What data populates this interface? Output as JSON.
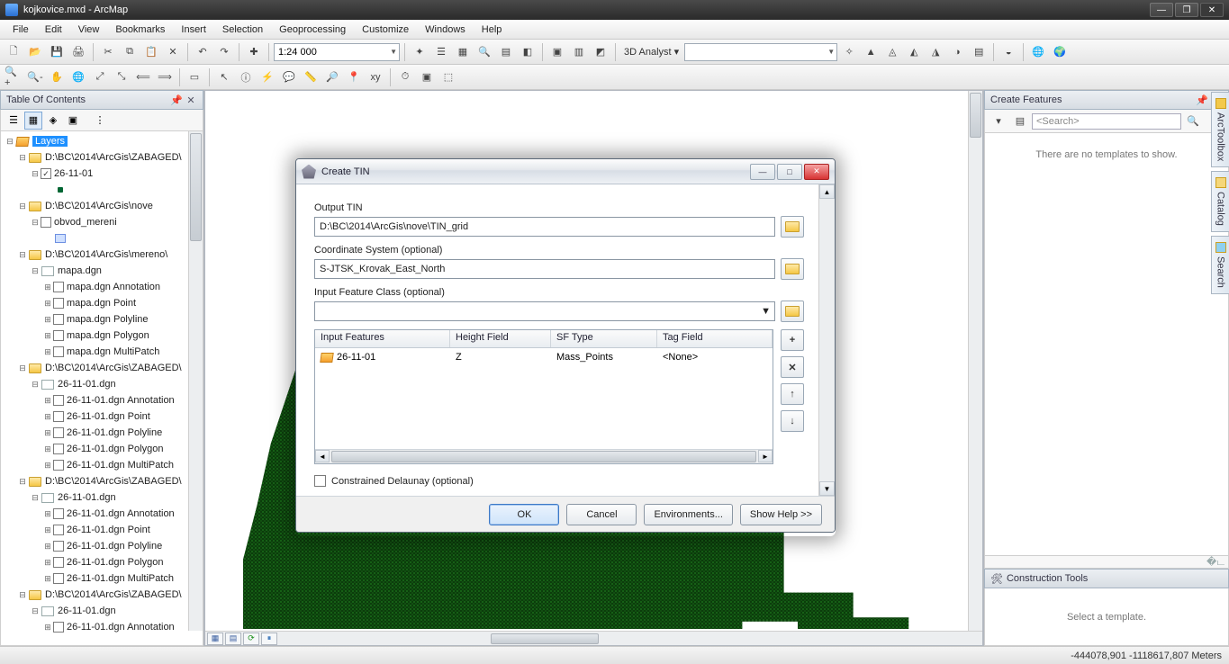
{
  "window": {
    "title": "kojkovice.mxd - ArcMap"
  },
  "menu": [
    "File",
    "Edit",
    "View",
    "Bookmarks",
    "Insert",
    "Selection",
    "Geoprocessing",
    "Customize",
    "Windows",
    "Help"
  ],
  "toolbar1": {
    "scale": "1:24 000",
    "analyst_label": "3D Analyst ▾",
    "analyst_combo": ""
  },
  "toc": {
    "title": "Table Of Contents",
    "root": "Layers",
    "groups": [
      {
        "path": "D:\\BC\\2014\\ArcGis\\ZABAGED\\",
        "children": [
          {
            "name": "26-11-01",
            "checked": true,
            "sym": "dot"
          }
        ]
      },
      {
        "path": "D:\\BC\\2014\\ArcGis\\nove",
        "children": [
          {
            "name": "obvod_mereni",
            "checked": false,
            "sym": "box"
          }
        ]
      },
      {
        "path": "D:\\BC\\2014\\ArcGis\\mereno\\",
        "children": [
          {
            "name": "mapa.dgn",
            "dgn": true,
            "sub": [
              "mapa.dgn Annotation",
              "mapa.dgn Point",
              "mapa.dgn Polyline",
              "mapa.dgn Polygon",
              "mapa.dgn MultiPatch"
            ]
          }
        ]
      },
      {
        "path": "D:\\BC\\2014\\ArcGis\\ZABAGED\\",
        "children": [
          {
            "name": "26-11-01.dgn",
            "dgn": true,
            "sub": [
              "26-11-01.dgn Annotation",
              "26-11-01.dgn Point",
              "26-11-01.dgn Polyline",
              "26-11-01.dgn Polygon",
              "26-11-01.dgn MultiPatch"
            ]
          }
        ]
      },
      {
        "path": "D:\\BC\\2014\\ArcGis\\ZABAGED\\",
        "children": [
          {
            "name": "26-11-01.dgn",
            "dgn": true,
            "sub": [
              "26-11-01.dgn Annotation",
              "26-11-01.dgn Point",
              "26-11-01.dgn Polyline",
              "26-11-01.dgn Polygon",
              "26-11-01.dgn MultiPatch"
            ]
          }
        ]
      },
      {
        "path": "D:\\BC\\2014\\ArcGis\\ZABAGED\\",
        "children": [
          {
            "name": "26-11-01.dgn",
            "dgn": true,
            "sub": [
              "26-11-01.dgn Annotation"
            ]
          }
        ]
      }
    ]
  },
  "create_features": {
    "title": "Create Features",
    "search_placeholder": "<Search>",
    "empty": "There are no templates to show."
  },
  "construction_tools": {
    "title": "Construction Tools",
    "empty": "Select a template."
  },
  "sidetabs": [
    "ArcToolbox",
    "Catalog",
    "Search"
  ],
  "dialog": {
    "title": "Create TIN",
    "labels": {
      "output": "Output TIN",
      "cs": "Coordinate System (optional)",
      "ifc": "Input Feature Class (optional)",
      "cd": "Constrained Delaunay (optional)"
    },
    "values": {
      "output": "D:\\BC\\2014\\ArcGis\\nove\\TIN_grid",
      "cs": "S-JTSK_Krovak_East_North",
      "ifc": ""
    },
    "columns": [
      "Input Features",
      "Height Field",
      "SF Type",
      "Tag Field"
    ],
    "row": {
      "feat": "26-11-01",
      "hf": "Z",
      "sf": "Mass_Points",
      "tag": "<None>"
    },
    "buttons": {
      "ok": "OK",
      "cancel": "Cancel",
      "env": "Environments...",
      "help": "Show Help >>"
    }
  },
  "status": {
    "coords": "-444078,901 -1118617,807 Meters"
  }
}
